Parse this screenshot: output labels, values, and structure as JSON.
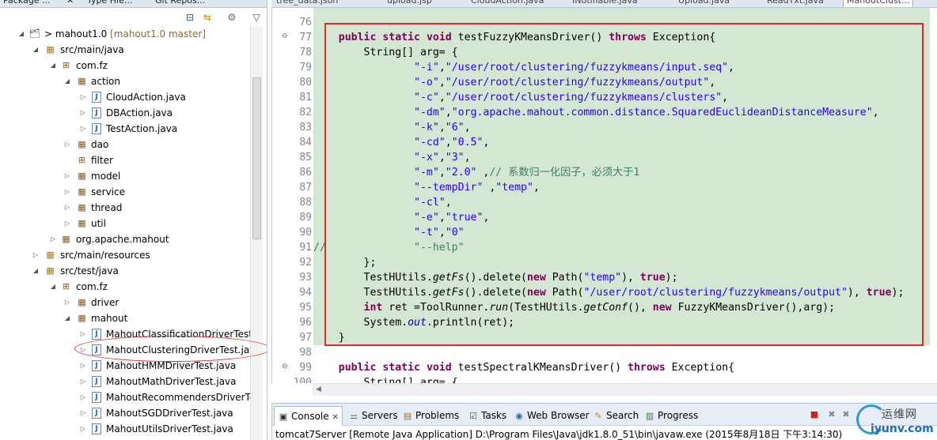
{
  "left_panel": {
    "tabs": [
      "Package ...",
      "Type Hie...",
      "Git Repos..."
    ],
    "tree": [
      {
        "label": "mahout1.0",
        "extra": "[mahout1.0 master]",
        "prefix": "> ",
        "icon": "project-icon"
      },
      {
        "label": "src/main/java",
        "icon": "source-folder-icon"
      },
      {
        "label": "com.fz",
        "icon": "package-icon"
      },
      {
        "label": "action",
        "icon": "package-icon"
      },
      {
        "label": "CloudAction.java",
        "icon": "java-file-icon"
      },
      {
        "label": "DBAction.java",
        "icon": "java-file-icon"
      },
      {
        "label": "TestAction.java",
        "icon": "java-file-icon"
      },
      {
        "label": "dao",
        "icon": "package-icon"
      },
      {
        "label": "filter",
        "icon": "package-icon"
      },
      {
        "label": "model",
        "icon": "package-icon"
      },
      {
        "label": "service",
        "icon": "package-icon"
      },
      {
        "label": "thread",
        "icon": "package-icon"
      },
      {
        "label": "util",
        "icon": "package-icon"
      },
      {
        "label": "org.apache.mahout",
        "icon": "package-icon"
      },
      {
        "label": "src/main/resources",
        "icon": "source-folder-icon"
      },
      {
        "label": "src/test/java",
        "icon": "source-folder-icon"
      },
      {
        "label": "com.fz",
        "icon": "package-icon"
      },
      {
        "label": "driver",
        "icon": "package-icon"
      },
      {
        "label": "mahout",
        "icon": "package-icon"
      },
      {
        "label": "MahoutClassificationDriverTest.java",
        "icon": "java-file-icon"
      },
      {
        "label": "MahoutClusteringDriverTest.java",
        "icon": "java-file-icon"
      },
      {
        "label": "MahoutHMMDriverTest.java",
        "icon": "java-file-icon"
      },
      {
        "label": "MahoutMathDriverTest.java",
        "icon": "java-file-icon"
      },
      {
        "label": "MahoutRecommendersDriverTest.java",
        "icon": "java-file-icon"
      },
      {
        "label": "MahoutSGDDriverTest.java",
        "icon": "java-file-icon"
      },
      {
        "label": "MahoutUtilsDriverTest.java",
        "icon": "java-file-icon"
      }
    ]
  },
  "editor": {
    "tabs": [
      "tree_data.json",
      "upload.jsp",
      "CloudAction.java",
      "INotifiable.java",
      "Upload.java",
      "ReadTxt.java",
      "MahoutClust..."
    ],
    "active_tab": "MahoutClust...",
    "line_numbers": [
      "76",
      "77",
      "78",
      "79",
      "80",
      "81",
      "82",
      "83",
      "84",
      "85",
      "86",
      "87",
      "88",
      "89",
      "90",
      "91",
      "92",
      "93",
      "94",
      "95",
      "96",
      "97",
      "98",
      "99",
      "100"
    ],
    "code_lines": [
      "",
      "    public static void testFuzzyKMeansDriver() throws Exception{",
      "        String[] arg= {",
      "                \"-i\",\"/user/root/clustering/fuzzykmeans/input.seq\",",
      "                \"-o\",\"/user/root/clustering/fuzzykmeans/output\",",
      "                \"-c\",\"/user/root/clustering/fuzzykmeans/clusters\",",
      "                \"-dm\",\"org.apache.mahout.common.distance.SquaredEuclideanDistanceMeasure\",",
      "                \"-k\",\"6\",",
      "                \"-cd\",\"0.5\",",
      "                \"-x\",\"3\",",
      "                \"-m\",\"2.0\" ,// 系数归一化因子，必须大于1",
      "                \"--tempDir\" ,\"temp\",",
      "                \"-cl\",",
      "                \"-e\",\"true\",",
      "                \"-t\",\"0\"",
      "//              \"--help\"",
      "        };",
      "        TestHUtils.getFs().delete(new Path(\"temp\"), true);",
      "        TestHUtils.getFs().delete(new Path(\"/user/root/clustering/fuzzykmeans/output\"), true);",
      "        int ret =ToolRunner.run(TestHUtils.getConf(), new FuzzyKMeansDriver(),arg);",
      "        System.out.println(ret);",
      "    }",
      "",
      "    public static void testSpectralKMeansDriver() throws Exception{",
      "        String[] arg= {"
    ]
  },
  "console": {
    "tabs": [
      {
        "label": "Console",
        "icon": "console-icon",
        "active": true
      },
      {
        "label": "Servers",
        "icon": "servers-icon"
      },
      {
        "label": "Problems",
        "icon": "problems-icon"
      },
      {
        "label": "Tasks",
        "icon": "tasks-icon"
      },
      {
        "label": "Web Browser",
        "icon": "web-browser-icon"
      },
      {
        "label": "Search",
        "icon": "search-icon"
      },
      {
        "label": "Progress",
        "icon": "progress-icon"
      }
    ],
    "status_line": "tomcat7Server [Remote Java Application] D:\\Program Files\\Java\\jdk1.8.0_51\\bin\\javaw.exe (2015年8月18日 下午3:14:30)"
  },
  "watermark": {
    "top": "运维网",
    "url": "iyunv.com"
  },
  "colors": {
    "highlight_bg": "#d4e7d2",
    "annotation_red": "#e02a2a",
    "keyword": "#7f0055",
    "string": "#2a00ff",
    "comment": "#3f7f5f"
  }
}
